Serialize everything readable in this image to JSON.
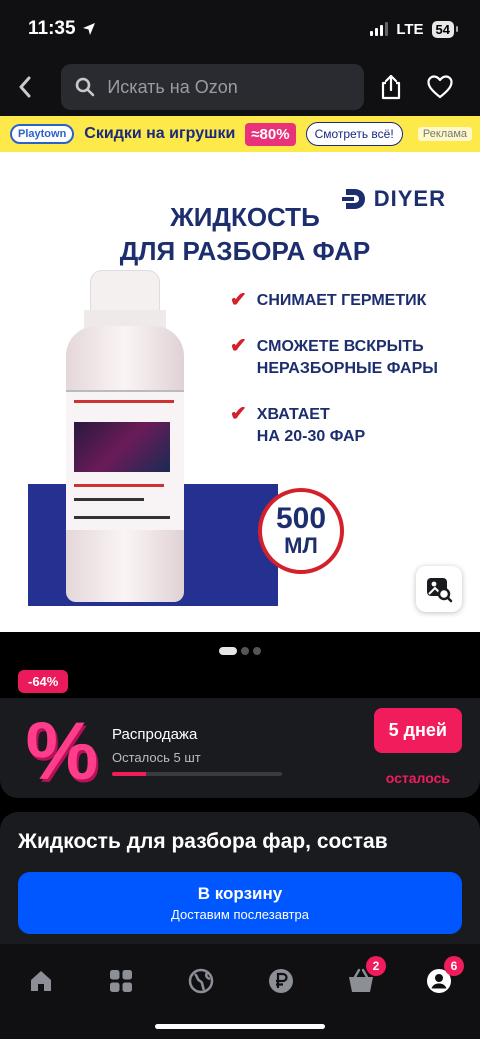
{
  "status": {
    "time": "11:35",
    "network": "LTE",
    "battery": "54"
  },
  "header": {
    "search_placeholder": "Искать на Ozon"
  },
  "ad": {
    "logo": "Playtown",
    "text": "Скидки на игрушки",
    "discount": "≈80%",
    "link": "Смотреть всё!",
    "label": "Реклама"
  },
  "product_image": {
    "brand": "DIYER",
    "headline_line1": "ЖИДКОСТЬ",
    "headline_line2": "ДЛЯ РАЗБОРА ФАР",
    "features": [
      {
        "line1": "СНИМАЕТ ГЕРМЕТИК",
        "line2": ""
      },
      {
        "line1": "СМОЖЕТЕ ВСКРЫТЬ",
        "line2": "НЕРАЗБОРНЫЕ ФАРЫ"
      },
      {
        "line1": "ХВАТАЕТ",
        "line2": "НА 20-30 ФАР"
      }
    ],
    "volume_number": "500",
    "volume_unit": "МЛ"
  },
  "gallery": {
    "total": 3,
    "active": 0
  },
  "discount_badge": "-64%",
  "sale": {
    "title": "Распродажа",
    "remaining": "Осталось 5 шт",
    "progress": 0.2,
    "days": "5 дней",
    "days_suffix": "осталось"
  },
  "product_title": "Жидкость для разбора фар, состав",
  "cart": {
    "label": "В корзину",
    "sub": "Доставим послезавтра"
  },
  "tabs": {
    "cart_badge": "2",
    "profile_badge": "6"
  },
  "colors": {
    "accent": "#0057ff",
    "sale": "#f01c5c",
    "brand_navy": "#1d2e6e"
  }
}
